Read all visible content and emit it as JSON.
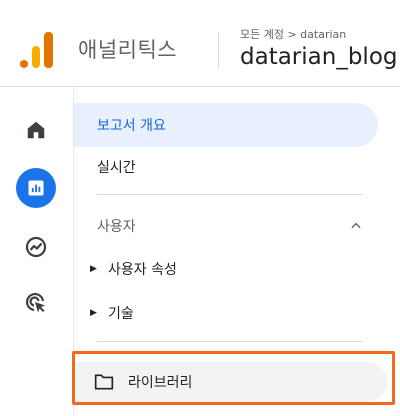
{
  "header": {
    "app_name": "애널리틱스",
    "breadcrumb": "모든 계정 > datarian",
    "property_name": "datarian_blog"
  },
  "rail": {
    "items": [
      {
        "icon": "home-icon"
      },
      {
        "icon": "reports-icon",
        "active": true
      },
      {
        "icon": "explore-icon"
      },
      {
        "icon": "advertising-icon"
      }
    ]
  },
  "nav": {
    "overview_label": "보고서 개요",
    "realtime_label": "실시간",
    "section_user": "사용자",
    "sub_user_attributes": "사용자 속성",
    "sub_tech": "기술",
    "library_label": "라이브러리"
  },
  "colors": {
    "accent": "#1a73e8",
    "logo_orange": "#e37400",
    "logo_yellow": "#f9ab00",
    "highlight_border": "#f26b1d",
    "active_bg": "#e8f0fe"
  }
}
